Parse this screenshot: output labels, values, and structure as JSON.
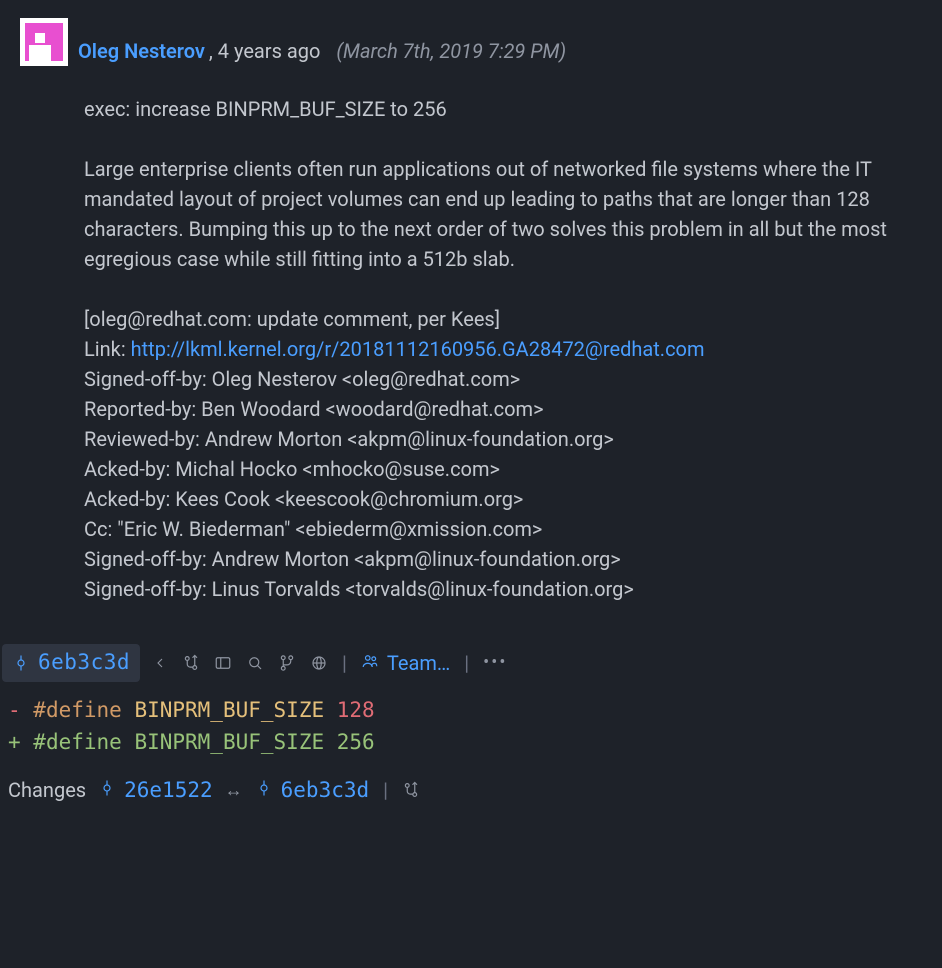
{
  "author": {
    "name": "Oleg Nesterov",
    "time_ago": ", 4 years ago",
    "timestamp": "(March 7th, 2019 7:29 PM)"
  },
  "commit": {
    "title": "exec: increase BINPRM_BUF_SIZE to 256",
    "body": "Large enterprise clients often run applications out of networked file systems where the IT mandated layout of project volumes can end up leading to paths that are longer than 128 characters. Bumping this up to the next order of two solves this problem in all but the most egregious case while still fitting into a 512b slab.",
    "note": "[oleg@redhat.com: update comment, per Kees]",
    "link_label": "Link: ",
    "link_url": "http://lkml.kernel.org/r/20181112160956.GA28472@redhat.com",
    "trailers": [
      "Signed-off-by: Oleg Nesterov <oleg@redhat.com>",
      "Reported-by: Ben Woodard <woodard@redhat.com>",
      "Reviewed-by: Andrew Morton <akpm@linux-foundation.org>",
      "Acked-by: Michal Hocko <mhocko@suse.com>",
      "Acked-by: Kees Cook <keescook@chromium.org>",
      "Cc: \"Eric W. Biederman\" <ebiederm@xmission.com>",
      "Signed-off-by: Andrew Morton <akpm@linux-foundation.org>",
      "Signed-off-by: Linus Torvalds <torvalds@linux-foundation.org>"
    ]
  },
  "toolbar": {
    "commit_hash": "6eb3c3d",
    "team_label": "Team…"
  },
  "diff": {
    "removed": {
      "sign": "-",
      "keyword": " #define ",
      "macro": "BINPRM_BUF_SIZE ",
      "value": "128"
    },
    "added": {
      "sign": "+",
      "keyword": " #define ",
      "macro": "BINPRM_BUF_SIZE ",
      "value": "256"
    }
  },
  "footer": {
    "label": "Changes",
    "from_hash": "26e1522",
    "arrow": "↔",
    "to_hash": "6eb3c3d"
  }
}
